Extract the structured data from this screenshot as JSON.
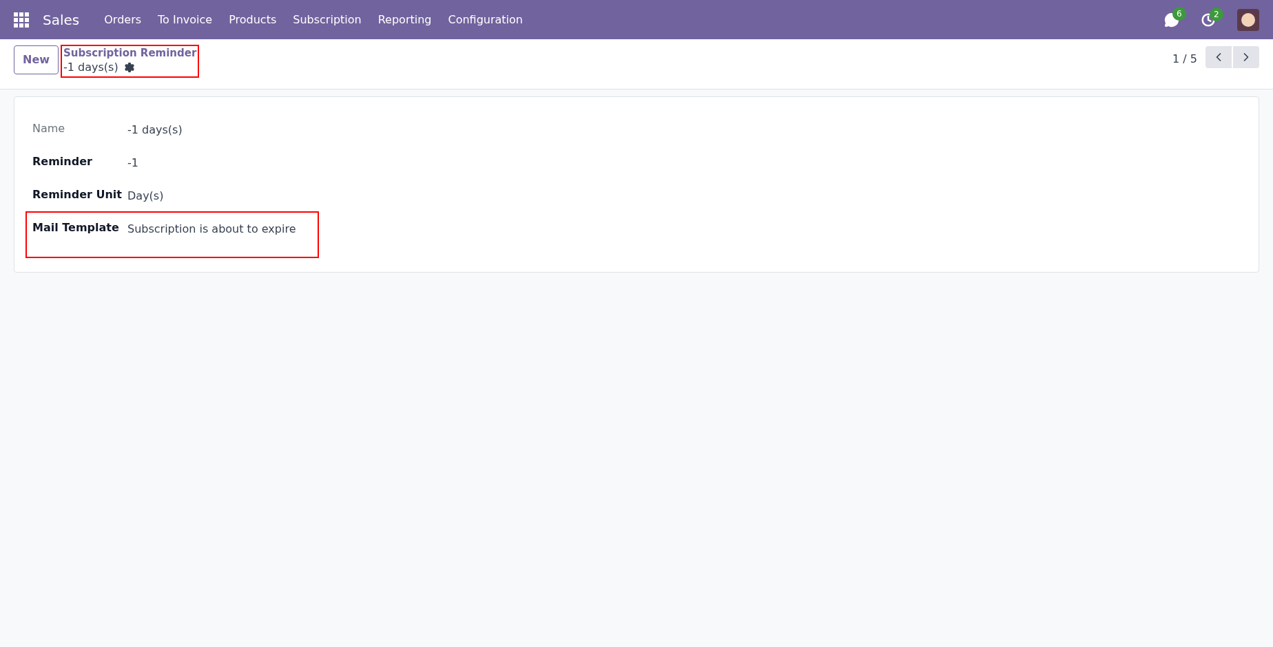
{
  "navbar": {
    "app": "Sales",
    "menu": [
      "Orders",
      "To Invoice",
      "Products",
      "Subscription",
      "Reporting",
      "Configuration"
    ],
    "messages_badge": "6",
    "activities_badge": "2"
  },
  "control_panel": {
    "new_button": "New",
    "breadcrumb": {
      "parent": "Subscription Reminder",
      "current": "-1 days(s)",
      "highlighted": true
    },
    "pager": "1 / 5"
  },
  "form": {
    "fields": [
      {
        "label": "Name",
        "value": "-1 days(s)",
        "kind": "plain",
        "highlighted": false
      },
      {
        "label": "Reminder",
        "value": "-1",
        "kind": "bold",
        "highlighted": false
      },
      {
        "label": "Reminder Unit",
        "value": "Day(s)",
        "kind": "bold",
        "highlighted": false
      },
      {
        "label": "Mail Template",
        "value": "Subscription is about to expire",
        "kind": "bold",
        "highlighted": true
      }
    ]
  }
}
